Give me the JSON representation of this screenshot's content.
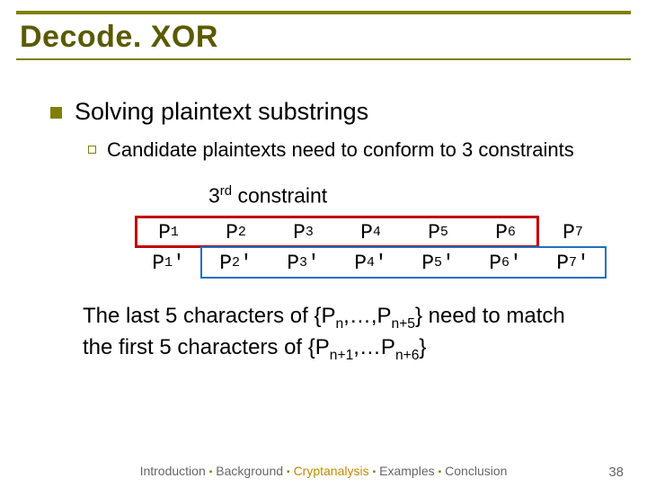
{
  "title": "Decode. XOR",
  "bullet1": "Solving plaintext substrings",
  "bullet2": "Candidate plaintexts need to conform to 3 constraints",
  "constraint_label_ord": "3",
  "constraint_label_suffix": "rd",
  "constraint_label_word": " constraint",
  "ptable": {
    "row1": [
      {
        "base": "P",
        "sub": "1",
        "prime": ""
      },
      {
        "base": "P",
        "sub": "2",
        "prime": ""
      },
      {
        "base": "P",
        "sub": "3",
        "prime": ""
      },
      {
        "base": "P",
        "sub": "4",
        "prime": ""
      },
      {
        "base": "P",
        "sub": "5",
        "prime": ""
      },
      {
        "base": "P",
        "sub": "6",
        "prime": ""
      },
      {
        "base": "P",
        "sub": "7",
        "prime": ""
      }
    ],
    "row2": [
      {
        "base": "P",
        "sub": "1",
        "prime": "'"
      },
      {
        "base": "P",
        "sub": "2",
        "prime": "'"
      },
      {
        "base": "P",
        "sub": "3",
        "prime": "'"
      },
      {
        "base": "P",
        "sub": "4",
        "prime": "'"
      },
      {
        "base": "P",
        "sub": "5",
        "prime": "'"
      },
      {
        "base": "P",
        "sub": "6",
        "prime": "'"
      },
      {
        "base": "P",
        "sub": "7",
        "prime": "'"
      }
    ]
  },
  "explain": {
    "pre": "The last 5 characters of {P",
    "sub1": "n",
    "mid1": ",…,P",
    "sub2": "n+5",
    "mid2": "} need to match the first 5 characters of {P",
    "sub3": "n+1",
    "mid3": ",…P",
    "sub4": "n+6",
    "end": "}"
  },
  "footer": {
    "items": [
      "Introduction",
      "Background",
      "Cryptanalysis",
      "Examples",
      "Conclusion"
    ],
    "highlight_index": 2
  },
  "page_number": "38"
}
